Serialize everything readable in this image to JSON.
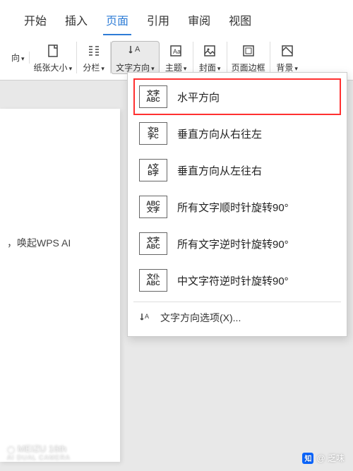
{
  "tabs": {
    "start": "开始",
    "insert": "插入",
    "page": "页面",
    "reference": "引用",
    "review": "审阅",
    "view": "视图"
  },
  "toolbar": {
    "orientation": "向",
    "paper_size": "纸张大小",
    "columns": "分栏",
    "text_direction": "文字方向",
    "theme": "主题",
    "cover": "封面",
    "page_border": "页面边框",
    "background": "背景"
  },
  "doc": {
    "hint": "，唤起WPS AI"
  },
  "dropdown": {
    "items": [
      {
        "icon_top": "文字",
        "icon_bottom": "ABC",
        "label": "水平方向"
      },
      {
        "icon_top": "文B",
        "icon_bottom": "字C",
        "label": "垂直方向从右往左"
      },
      {
        "icon_top": "A文",
        "icon_bottom": "B字",
        "label": "垂直方向从左往右"
      },
      {
        "icon_top": "ABC",
        "icon_bottom": "文字",
        "label": "所有文字顺时针旋转90°"
      },
      {
        "icon_top": "文字",
        "icon_bottom": "ABC",
        "label": "所有文字逆时针旋转90°"
      },
      {
        "icon_top": "文仆",
        "icon_bottom": "ABC",
        "label": "中文字符逆时针旋转90°"
      }
    ],
    "options": "文字方向选项(X)..."
  },
  "watermark": {
    "device": "MEIZU 16th",
    "camera": "AI DUAL CAMERA",
    "author": "@ 乏味"
  }
}
